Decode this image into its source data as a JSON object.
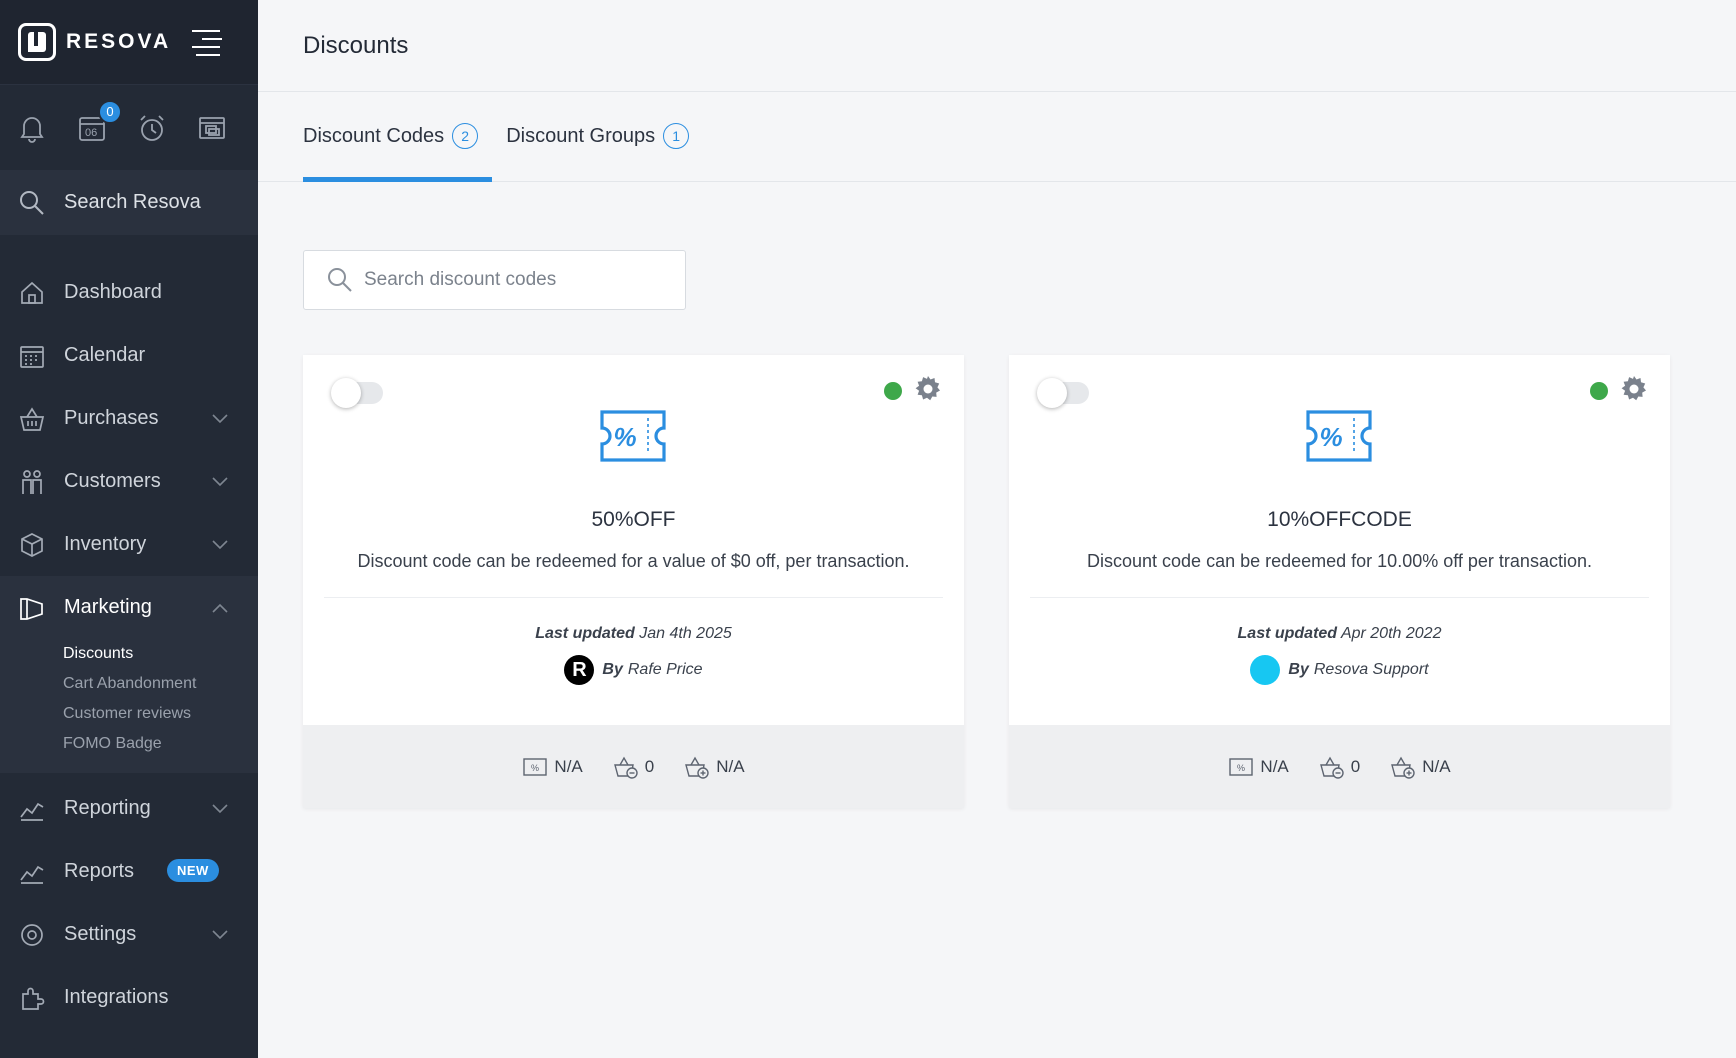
{
  "brand": {
    "name": "RESOVA"
  },
  "quick": {
    "calendar_badge": "0",
    "calendar_day": "06"
  },
  "sidebar_search": {
    "label": "Search Resova"
  },
  "nav": {
    "dashboard": "Dashboard",
    "calendar": "Calendar",
    "purchases": "Purchases",
    "customers": "Customers",
    "inventory": "Inventory",
    "marketing": "Marketing",
    "marketing_sub": [
      "Discounts",
      "Cart Abandonment",
      "Customer reviews",
      "FOMO Badge"
    ],
    "reporting": "Reporting",
    "reports": "Reports",
    "reports_badge": "NEW",
    "settings": "Settings",
    "integrations": "Integrations"
  },
  "page": {
    "title": "Discounts"
  },
  "tabs": [
    {
      "label": "Discount Codes",
      "count": "2"
    },
    {
      "label": "Discount Groups",
      "count": "1"
    }
  ],
  "search": {
    "placeholder": "Search discount codes"
  },
  "colors": {
    "accent": "#2b8ee0",
    "active_status": "#3ea84a",
    "sidebar_bg": "#232a36"
  },
  "cards": [
    {
      "code": "50%OFF",
      "description": "Discount code can be redeemed for a value of $0 off, per transaction.",
      "updated_label": "Last updated",
      "updated_date": "Jan 4th 2025",
      "by_label": "By",
      "by_name": "Rafe Price",
      "avatar_letter": "R",
      "stat_value": "N/A",
      "stat_used": "0",
      "stat_limit": "N/A"
    },
    {
      "code": "10%OFFCODE",
      "description": "Discount code can be redeemed for 10.00% off per transaction.",
      "updated_label": "Last updated",
      "updated_date": "Apr 20th 2022",
      "by_label": "By",
      "by_name": "Resova Support",
      "avatar_letter": "",
      "stat_value": "N/A",
      "stat_used": "0",
      "stat_limit": "N/A"
    }
  ]
}
